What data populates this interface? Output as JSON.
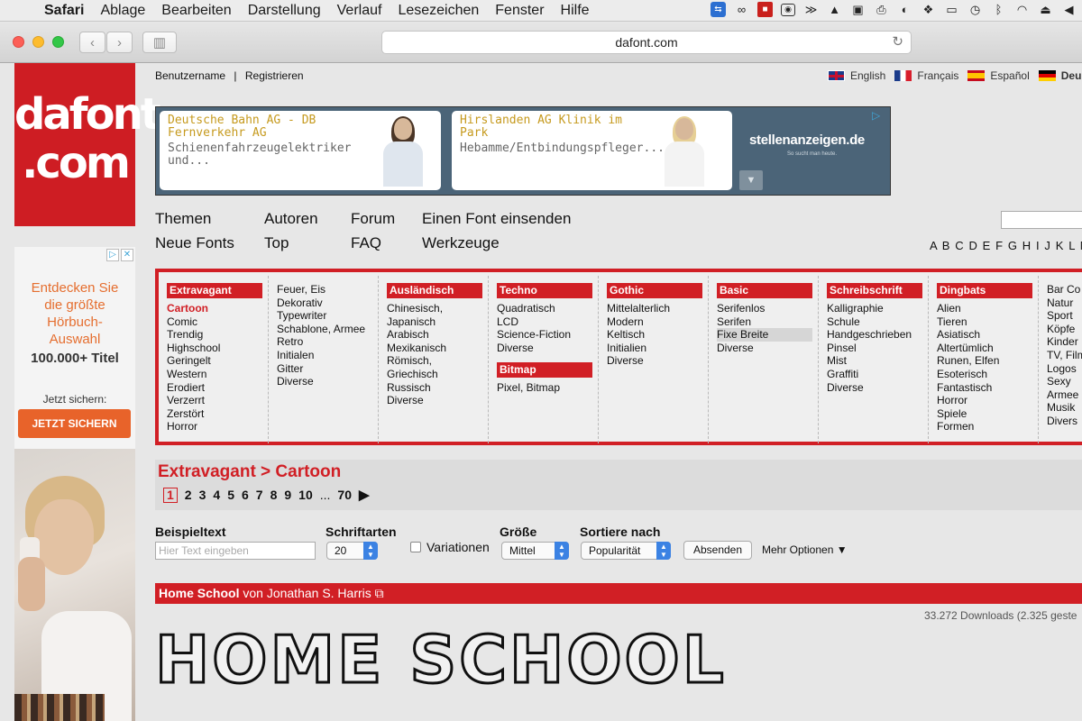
{
  "menubar": {
    "app": "Safari",
    "items": [
      "Ablage",
      "Bearbeiten",
      "Darstellung",
      "Verlauf",
      "Lesezeichen",
      "Fenster",
      "Hilfe"
    ]
  },
  "browser": {
    "url": "dafont.com"
  },
  "site": {
    "logo_line1": "dafont",
    "logo_line2": ".com",
    "user": {
      "login": "Benutzername",
      "separator": "|",
      "register": "Registrieren"
    },
    "languages": [
      "English",
      "Français",
      "Español",
      "Deu"
    ]
  },
  "ad_banner": {
    "card1": {
      "title": "Deutsche Bahn AG - DB Fernverkehr AG",
      "desc": "Schienenfahrzeugelektriker und..."
    },
    "card2": {
      "title": "Hirslanden AG Klinik im Park",
      "desc": "Hebamme/Entbindungspfleger..."
    },
    "brand": "stellenanzeigen.de",
    "brand_sub": "So sucht man heute."
  },
  "nav": {
    "row1": [
      "Themen",
      "Autoren",
      "Forum",
      "Einen Font einsenden"
    ],
    "row2": [
      "Neue Fonts",
      "Top",
      "FAQ",
      "Werkzeuge"
    ],
    "alphabet": "A B C D E F G H I J K L M"
  },
  "categories": [
    {
      "header": "Extravagant",
      "items": [
        "Cartoon",
        "Comic",
        "Trendig",
        "Highschool",
        "Geringelt",
        "Western",
        "Erodiert",
        "Verzerrt",
        "Zerstört",
        "Horror"
      ],
      "active": "Cartoon"
    },
    {
      "header": "",
      "items": [
        "Feuer, Eis",
        "Dekorativ",
        "Typewriter",
        "Schablone, Armee",
        "Retro",
        "Initialen",
        "Gitter",
        "Diverse"
      ]
    },
    {
      "header": "Ausländisch",
      "items": [
        "Chinesisch, Japanisch",
        "Arabisch",
        "Mexikanisch",
        "Römisch, Griechisch",
        "Russisch",
        "Diverse"
      ]
    },
    {
      "header": "Techno",
      "items": [
        "Quadratisch",
        "LCD",
        "Science-Fiction",
        "Diverse"
      ],
      "header2": "Bitmap",
      "items2": [
        "Pixel, Bitmap"
      ]
    },
    {
      "header": "Gothic",
      "items": [
        "Mittelalterlich",
        "Modern",
        "Keltisch",
        "Initialien",
        "Diverse"
      ]
    },
    {
      "header": "Basic",
      "items": [
        "Serifenlos",
        "Serifen",
        "Fixe Breite",
        "Diverse"
      ],
      "hover": "Fixe Breite"
    },
    {
      "header": "Schreibschrift",
      "items": [
        "Kalligraphie",
        "Schule",
        "Handgeschrieben",
        "Pinsel",
        "Mist",
        "Graffiti",
        "Diverse"
      ]
    },
    {
      "header": "Dingbats",
      "items": [
        "Alien",
        "Tieren",
        "Asiatisch",
        "Altertümlich",
        "Runen, Elfen",
        "Esoterisch",
        "Fantastisch",
        "Horror",
        "Spiele",
        "Formen"
      ]
    },
    {
      "header": "",
      "items": [
        "Bar Co",
        "Natur",
        "Sport",
        "Köpfe",
        "Kinder",
        "TV, Film",
        "Logos",
        "Sexy",
        "Armee",
        "Musik",
        "Divers"
      ]
    }
  ],
  "breadcrumb": "Extravagant > Cartoon",
  "pager": {
    "current": "1",
    "pages": [
      "2",
      "3",
      "4",
      "5",
      "6",
      "7",
      "8",
      "9",
      "10"
    ],
    "ellipsis": "...",
    "last": "70",
    "next": "▶"
  },
  "options": {
    "sample_label": "Beispieltext",
    "sample_placeholder": "Hier Text eingeben",
    "count_label": "Schriftarten",
    "count_value": "20",
    "variations_label": "Variationen",
    "size_label": "Größe",
    "size_value": "Mittel",
    "sort_label": "Sortiere nach",
    "sort_value": "Popularität",
    "submit": "Absenden",
    "more": "Mehr Optionen"
  },
  "font_entry": {
    "name": "Home School",
    "by": "von Jonathan S. Harris",
    "downloads": "33.272 Downloads (2.325 geste",
    "preview_text": "HOME SCHOOL"
  },
  "left_ad": {
    "headline_lines": [
      "Entdecken Sie",
      "die größte",
      "Hörbuch-",
      "Auswahl"
    ],
    "number": "100.000+ Titel",
    "cta_text": "Jetzt sichern:",
    "button": "JETZT SICHERN"
  }
}
